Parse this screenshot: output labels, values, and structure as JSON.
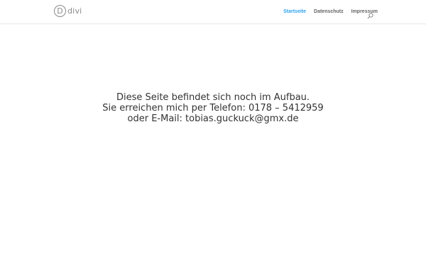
{
  "header": {
    "logo_text": "divi",
    "logo_letter": "D",
    "nav": [
      {
        "label": "Startseite",
        "active": true
      },
      {
        "label": "Datenschutz",
        "active": false
      },
      {
        "label": "Impressum",
        "active": false
      }
    ],
    "search_icon": "search-icon"
  },
  "main": {
    "lines": [
      "Diese Seite befindet sich noch im Aufbau.",
      "Sie erreichen mich per Telefon: 0178 – 5412959",
      "oder E-Mail: tobias.guckuck@gmx.de"
    ]
  },
  "colors": {
    "accent": "#2ea3f2",
    "nav_text": "#666666",
    "body_text": "#333333"
  }
}
